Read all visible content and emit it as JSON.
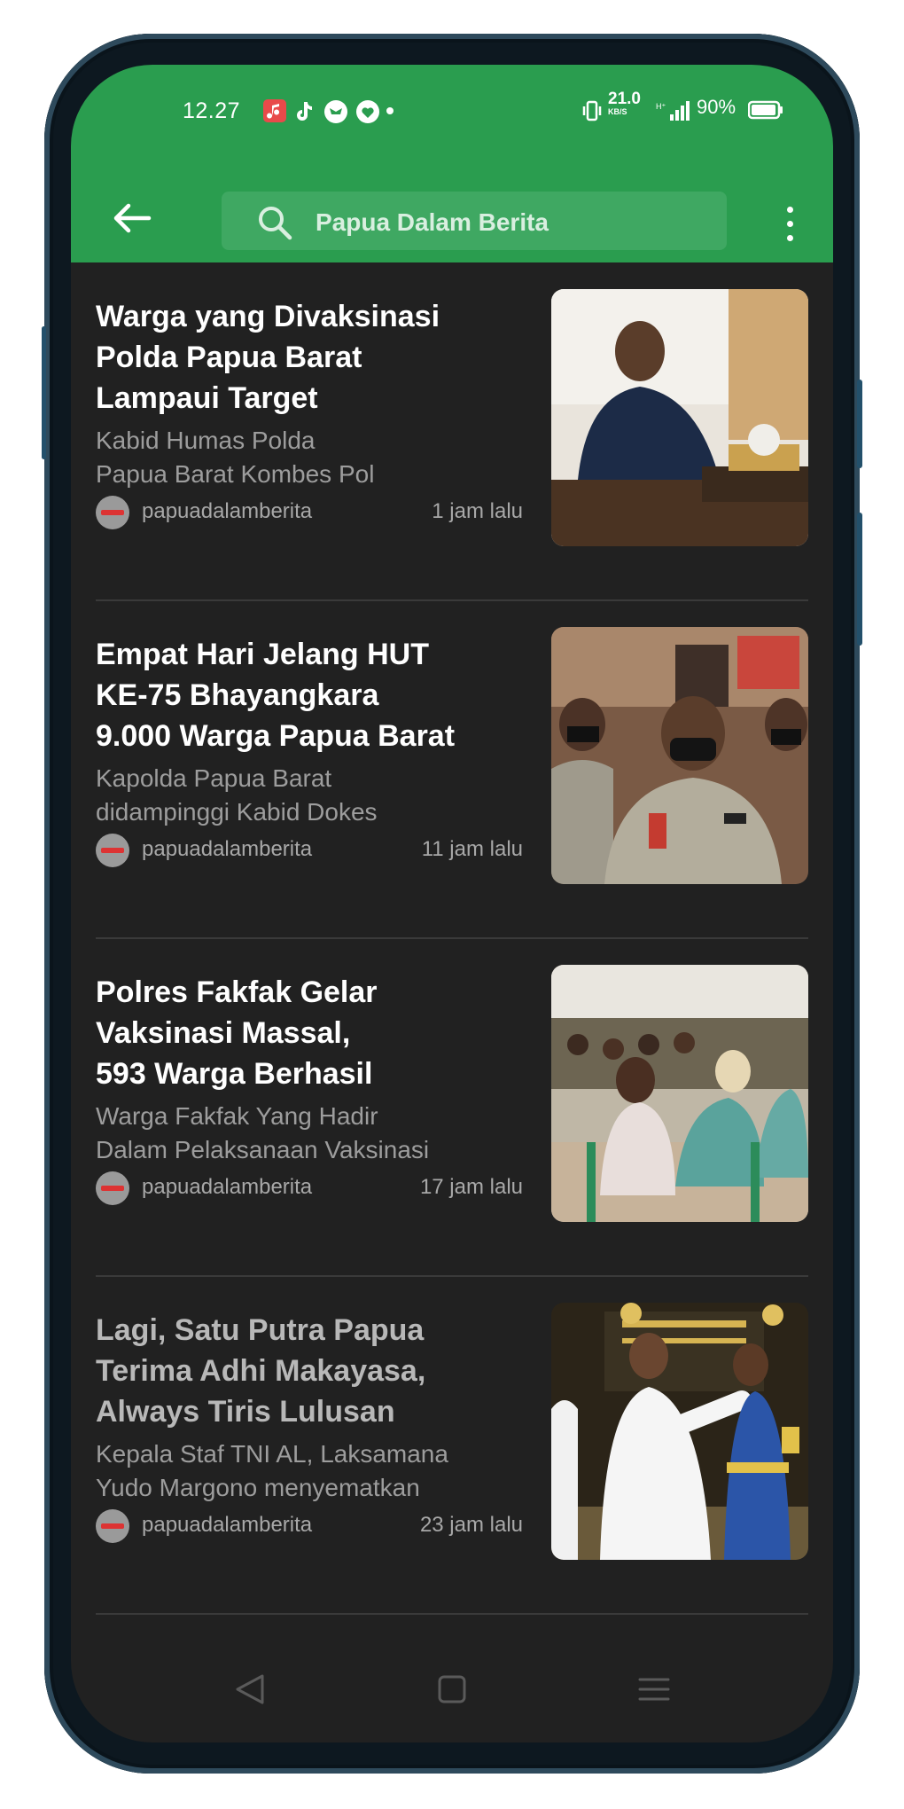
{
  "status_bar": {
    "time": "12.27",
    "network_speed": "21.0",
    "network_unit": "KB/S",
    "battery": "90%"
  },
  "app_bar": {
    "search_text": "Papua Dalam Berita"
  },
  "articles": [
    {
      "title": "Warga yang Divaksinasi\nPolda Papua Barat\nLampaui Target",
      "description": "Kabid Humas Polda\nPapua Barat Kombes Pol",
      "source": "papuadalamberita",
      "time": "1 jam lalu"
    },
    {
      "title": "Empat Hari Jelang HUT\nKE-75 Bhayangkara\n9.000 Warga Papua Barat",
      "description": "Kapolda Papua Barat\ndidampinggi  Kabid Dokes",
      "source": "papuadalamberita",
      "time": "11 jam lalu"
    },
    {
      "title": "Polres Fakfak Gelar\nVaksinasi Massal,\n 593 Warga Berhasil",
      "description": "Warga Fakfak Yang Hadir\nDalam Pelaksanaan Vaksinasi",
      "source": "papuadalamberita",
      "time": "17 jam lalu"
    },
    {
      "title": "Lagi, Satu Putra Papua\nTerima Adhi Makayasa,\nAlways Tiris Lulusan",
      "description": "Kepala Staf TNI AL, Laksamana\nYudo Margono menyematkan",
      "source": "papuadalamberita",
      "time": "23 jam lalu"
    }
  ],
  "colors": {
    "app_bar": "#2a9d4f",
    "background": "#212121",
    "title_text": "#ffffff"
  }
}
